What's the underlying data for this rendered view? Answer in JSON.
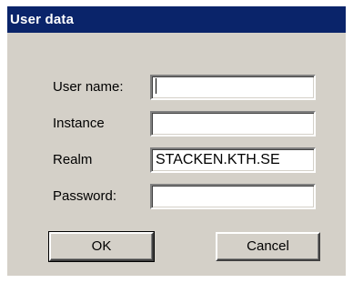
{
  "dialog": {
    "title": "User data",
    "fields": {
      "user_name": {
        "label": "User name:",
        "value": ""
      },
      "instance": {
        "label": "Instance",
        "value": ""
      },
      "realm": {
        "label": "Realm",
        "value": "STACKEN.KTH.SE"
      },
      "password": {
        "label": "Password:",
        "value": ""
      }
    },
    "buttons": {
      "ok_label": "OK",
      "cancel_label": "Cancel"
    }
  },
  "colors": {
    "titlebar": "#0a246a",
    "dialog_face": "#d4d0c8",
    "input_background": "#ffffff"
  }
}
